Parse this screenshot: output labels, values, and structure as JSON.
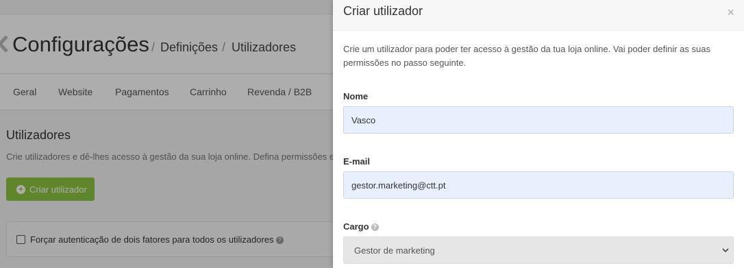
{
  "background": {
    "page_title": "Configurações",
    "breadcrumbs": [
      "Definições",
      "Utilizadores"
    ],
    "breadcrumb_separator": "/",
    "tabs": [
      "Geral",
      "Website",
      "Pagamentos",
      "Carrinho",
      "Revenda / B2B"
    ],
    "section_title": "Utilizadores",
    "section_description": "Crie utilizadores e dê-lhes acesso à gestão da sua loja online. Defina permissões e ac",
    "create_button": "Criar utilizador",
    "twofa_label": "Forçar autenticação de dois fatores para todos os utilizadores",
    "accent_color": "#8dc63f"
  },
  "modal": {
    "title": "Criar utilizador",
    "close_label": "×",
    "intro": "Crie um utilizador para poder ter acesso à gestão da tua loja online. Vai poder definir as suas permissões no passo seguinte.",
    "name_label": "Nome",
    "name_value": "Vasco",
    "email_label": "E-mail",
    "email_value": "gestor.marketing@ctt.pt",
    "role_label": "Cargo",
    "role_value": "Gestor de marketing"
  }
}
